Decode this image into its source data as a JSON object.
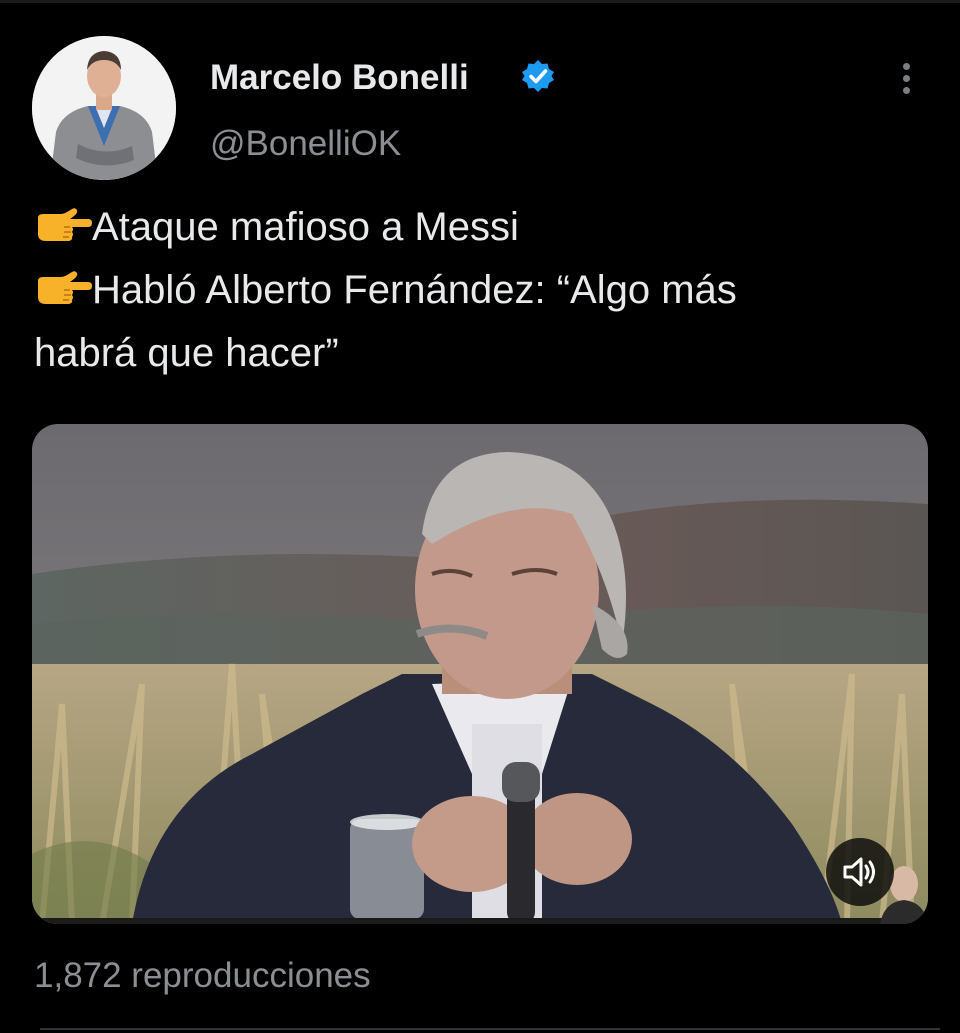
{
  "author": {
    "display_name": "Marcelo Bonelli",
    "handle": "@BonelliOK",
    "verified_icon": "verified-badge-icon",
    "avatar_icon": "profile-photo"
  },
  "menu": {
    "icon": "more-vertical-icon"
  },
  "tweet": {
    "lines": [
      {
        "icon": "pointing-right-hand-icon",
        "text": "Ataque mafioso a Messi"
      },
      {
        "icon": "pointing-right-hand-icon",
        "text": "Habló Alberto Fernández: “Algo más"
      },
      {
        "icon": "",
        "text": "habrá que hacer”"
      }
    ]
  },
  "media": {
    "type": "video",
    "mute_icon": "speaker-muted-icon"
  },
  "stats": {
    "views": "1,872 reproducciones"
  },
  "colors": {
    "background": "#000000",
    "text_primary": "#e7e9ea",
    "text_secondary": "#8b8f94",
    "verified_blue": "#1d9bf0",
    "emoji_yellow": "#f7b22a"
  }
}
